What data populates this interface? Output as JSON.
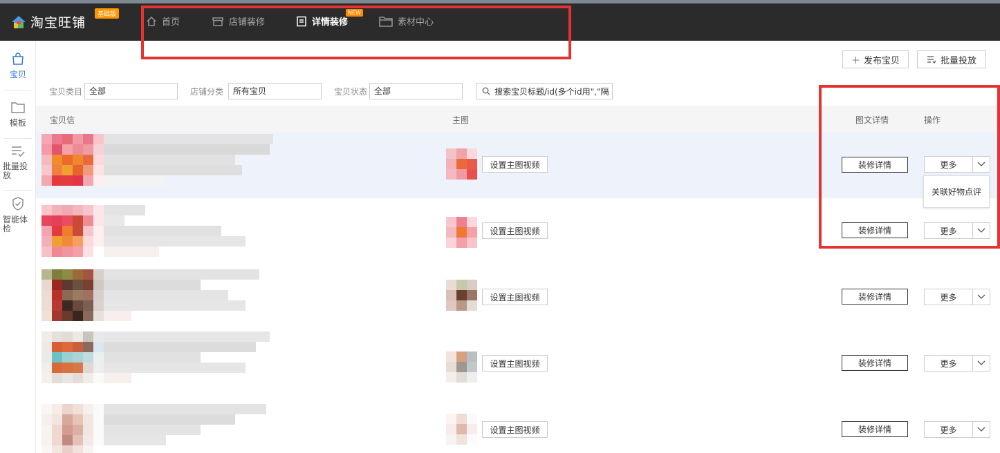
{
  "app": {
    "name": "淘宝旺铺",
    "edition": "基础版",
    "new_badge": "NEW"
  },
  "nav": {
    "items": [
      {
        "label": "首页",
        "icon": "home-icon"
      },
      {
        "label": "店铺装修",
        "icon": "store-icon"
      },
      {
        "label": "详情装修",
        "icon": "document-icon",
        "active": true
      },
      {
        "label": "素材中心",
        "icon": "folder-icon"
      }
    ]
  },
  "sidebar": {
    "items": [
      {
        "label": "宝贝",
        "icon": "bag-icon",
        "active": true
      },
      {
        "label": "模板",
        "icon": "folder-icon"
      },
      {
        "label": "批量投放",
        "icon": "list-check-icon"
      },
      {
        "label": "智能体检",
        "icon": "shield-check-icon"
      }
    ]
  },
  "toolbar": {
    "publish_label": "发布宝贝",
    "batch_label": "批量投放"
  },
  "filters": {
    "category_label": "宝贝类目",
    "category_value": "全部",
    "shop_category_label": "店铺分类",
    "shop_category_value": "所有宝贝",
    "status_label": "宝贝状态",
    "status_value": "全部",
    "search_placeholder": "搜索宝贝标题/id(多个id用\",\"隔"
  },
  "table": {
    "headers": {
      "item": "宝贝信",
      "main_image": "主图",
      "detail": "图文详情",
      "action": "操作"
    },
    "rows": [
      {
        "video_btn": "设置主图视频",
        "decor_btn": "装修详情",
        "more_btn": "更多"
      },
      {
        "video_btn": "设置主图视频",
        "decor_btn": "装修详情",
        "more_btn": "更多"
      },
      {
        "video_btn": "设置主图视频",
        "decor_btn": "装修详情",
        "more_btn": "更多"
      },
      {
        "video_btn": "设置主图视频",
        "decor_btn": "装修详情",
        "more_btn": "更多"
      },
      {
        "video_btn": "设置主图视频",
        "decor_btn": "装修详情",
        "more_btn": "更多"
      }
    ]
  },
  "dropdown": {
    "item_label": "关联好物点评"
  },
  "colors": {
    "topbar": "#2b2b2b",
    "annotation_red": "#e53333",
    "accent_blue": "#3a7bd5",
    "badge_orange": "#ff9500"
  }
}
